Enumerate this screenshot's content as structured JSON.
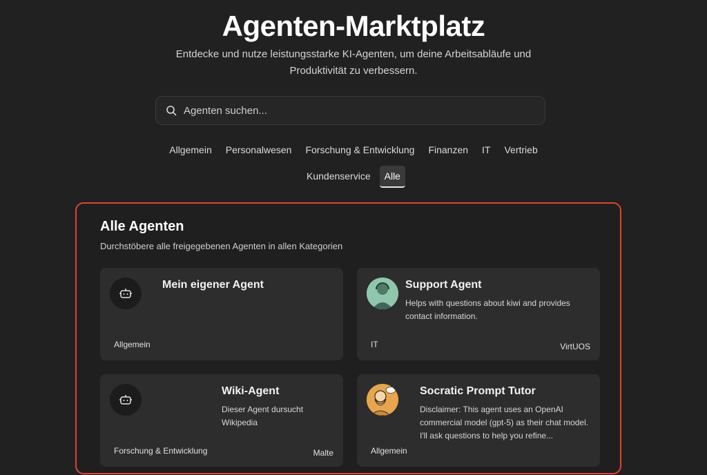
{
  "header": {
    "title": "Agenten-Marktplatz",
    "subtitle": "Entdecke und nutze leistungsstarke KI-Agenten, um deine Arbeitsabläufe und Produktivität zu verbessern."
  },
  "search": {
    "placeholder": "Agenten suchen...",
    "value": ""
  },
  "categories": {
    "row1": [
      "Allgemein",
      "Personalwesen",
      "Forschung & Entwicklung",
      "Finanzen",
      "IT",
      "Vertrieb"
    ],
    "row2": [
      "Kundenservice",
      "Alle"
    ],
    "active": "Alle"
  },
  "section": {
    "title": "Alle Agenten",
    "description": "Durchstöbere alle freigegebenen Agenten in allen Kategorien",
    "highlight_color": "#e0452e"
  },
  "agents": [
    {
      "name": "Mein eigener Agent",
      "description": "",
      "category": "Allgemein",
      "author": "",
      "icon": "robot-icon"
    },
    {
      "name": "Support Agent",
      "description": "Helps with questions about kiwi and provides contact information.",
      "category": "IT",
      "author": "VirtUOS",
      "icon": "support-avatar"
    },
    {
      "name": "Wiki-Agent",
      "description": "Dieser Agent dursucht Wikipedia",
      "category": "Forschung & Entwicklung",
      "author": "Malte",
      "icon": "robot-icon"
    },
    {
      "name": "Socratic Prompt Tutor",
      "description": "Disclaimer: This agent uses an OpenAI commercial model (gpt-5) as their chat model. I'll ask questions to help you refine...",
      "category": "Allgemein",
      "author": "",
      "icon": "socrates-avatar"
    }
  ]
}
